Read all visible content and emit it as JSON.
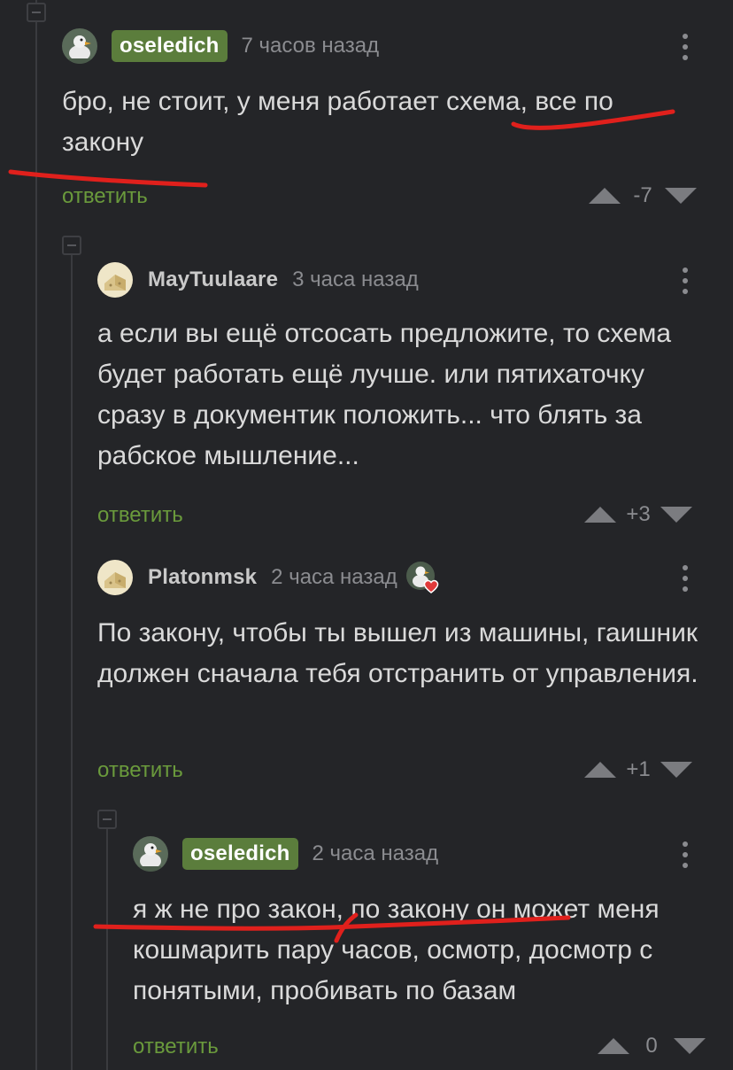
{
  "comments": [
    {
      "author": "oseledich",
      "time": "7 часов назад",
      "text": "бро, не стоит, у меня работает схема, все по закону",
      "reply": "ответить",
      "score": "-7",
      "avatar_icon": "duck-avatar-icon",
      "op": true
    },
    {
      "author": "MayTuulaare",
      "time": "3 часа назад",
      "text": "а если вы ещё отсосать предложите, то схема будет работать ещё лучше. или пятихаточку сразу в документик положить... что блять за рабское мышление...",
      "reply": "ответить",
      "score": "+3",
      "avatar_icon": "default-avatar-icon",
      "op": false
    },
    {
      "author": "Platonmsk",
      "time": "2 часа назад",
      "text": "По закону, чтобы ты вышел из машины, гаишник должен сначала тебя отстранить от управления.",
      "reply": "ответить",
      "score": "+1",
      "avatar_icon": "default-avatar-icon",
      "badge_icon": "duck-heart-badge-icon",
      "op": false
    },
    {
      "author": "oseledich",
      "time": "2 часа назад",
      "text": "я ж не про закон, по закону он может меня кошмарить пару часов, осмотр, досмотр с понятыми, пробивать по базам",
      "reply": "ответить",
      "score": "0",
      "avatar_icon": "duck-avatar-icon",
      "op": true
    }
  ],
  "colors": {
    "background": "#242528",
    "op_badge": "#5b7d3c",
    "reply_link": "#6a9a3c",
    "annotation": "#e0201c"
  }
}
